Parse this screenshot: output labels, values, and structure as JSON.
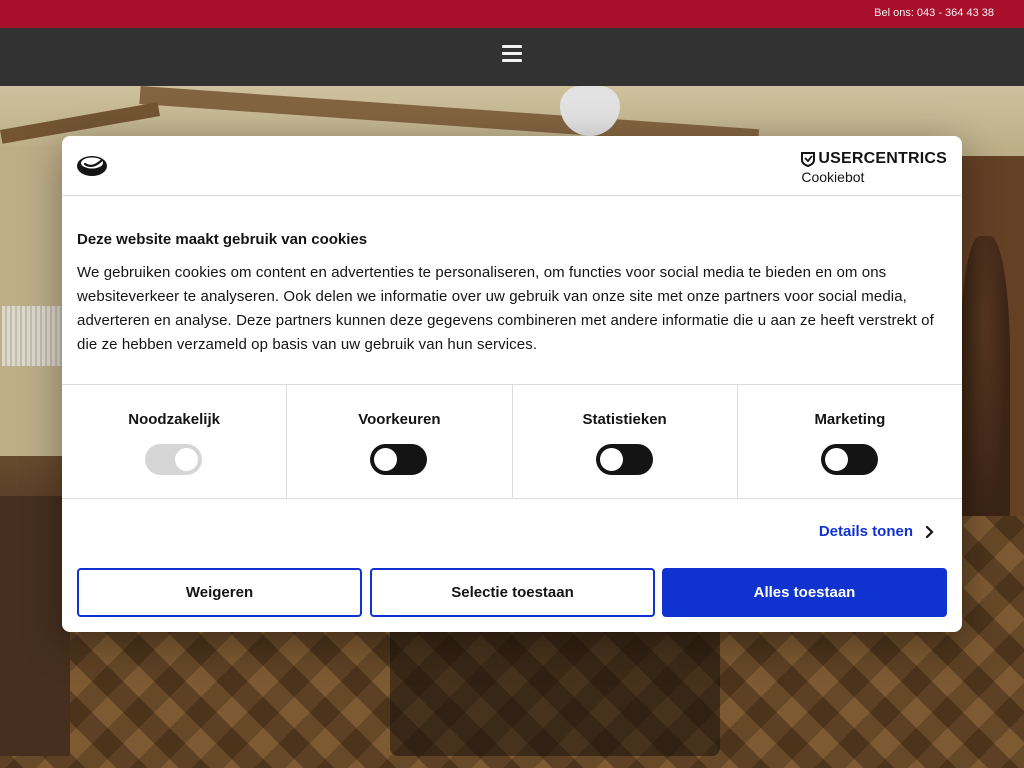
{
  "topbar": {
    "phone_text": "Bel ons: 043 - 364 43 38"
  },
  "navbar": {
    "menu_icon": "hamburger-menu-icon"
  },
  "cookie_dialog": {
    "brand": {
      "logo_top": "USERCENTRICS",
      "logo_sub": "Cookiebot"
    },
    "title": "Deze website maakt gebruik van cookies",
    "text": "We gebruiken cookies om content en advertenties te personaliseren, om functies voor social media te bieden en om ons websiteverkeer te analyseren. Ook delen we informatie over uw gebruik van onze site met onze partners voor social media, adverteren en analyse. Deze partners kunnen deze gegevens combineren met andere informatie die u aan ze heeft verstrekt of die ze hebben verzameld op basis van uw gebruik van hun services.",
    "categories": [
      {
        "label": "Noodzakelijk",
        "state": "on-disabled"
      },
      {
        "label": "Voorkeuren",
        "state": "off"
      },
      {
        "label": "Statistieken",
        "state": "off"
      },
      {
        "label": "Marketing",
        "state": "off"
      }
    ],
    "details_link": "Details tonen",
    "buttons": {
      "reject": "Weigeren",
      "selection": "Selectie toestaan",
      "allow_all": "Alles toestaan"
    },
    "colors": {
      "accent": "#1032cf",
      "topbar": "#b2102e",
      "navbar": "#353535"
    }
  }
}
